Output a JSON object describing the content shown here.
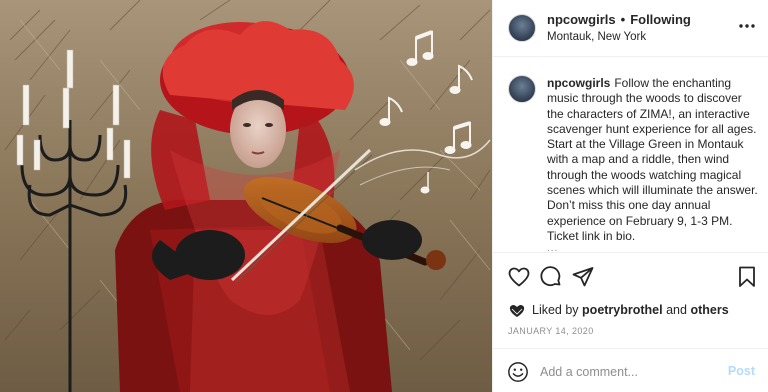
{
  "post": {
    "username": "npcowgirls",
    "separator": "•",
    "follow_status": "Following",
    "location": "Montauk, New York",
    "more_icon": "more-horizontal-icon",
    "caption": "Follow the enchanting music through the woods to discover the characters of ZIMA!, an interactive scavenger hunt experience for all ages. Start at the Village Green in Montauk with a map and a riddle, then wind through the woods watching magical scenes which will illuminate the answer. Don’t miss this one day annual experience on February 9, 1-3 PM. Ticket link in bio.",
    "more_caption_indicator": "..."
  },
  "actions": {
    "like_icon": "heart-icon",
    "comment_icon": "comment-icon",
    "share_icon": "share-icon",
    "save_icon": "bookmark-icon"
  },
  "likes": {
    "prefix": "Liked by",
    "user": "poetrybrothel",
    "conjunction": "and",
    "others": "others"
  },
  "date": "JANUARY 14, 2020",
  "comment": {
    "placeholder": "Add a comment...",
    "post_label": "Post"
  },
  "colors": {
    "text": "#262626",
    "muted": "#8e8e8e",
    "post_disabled": "#b3dbff",
    "border": "#efefef"
  }
}
